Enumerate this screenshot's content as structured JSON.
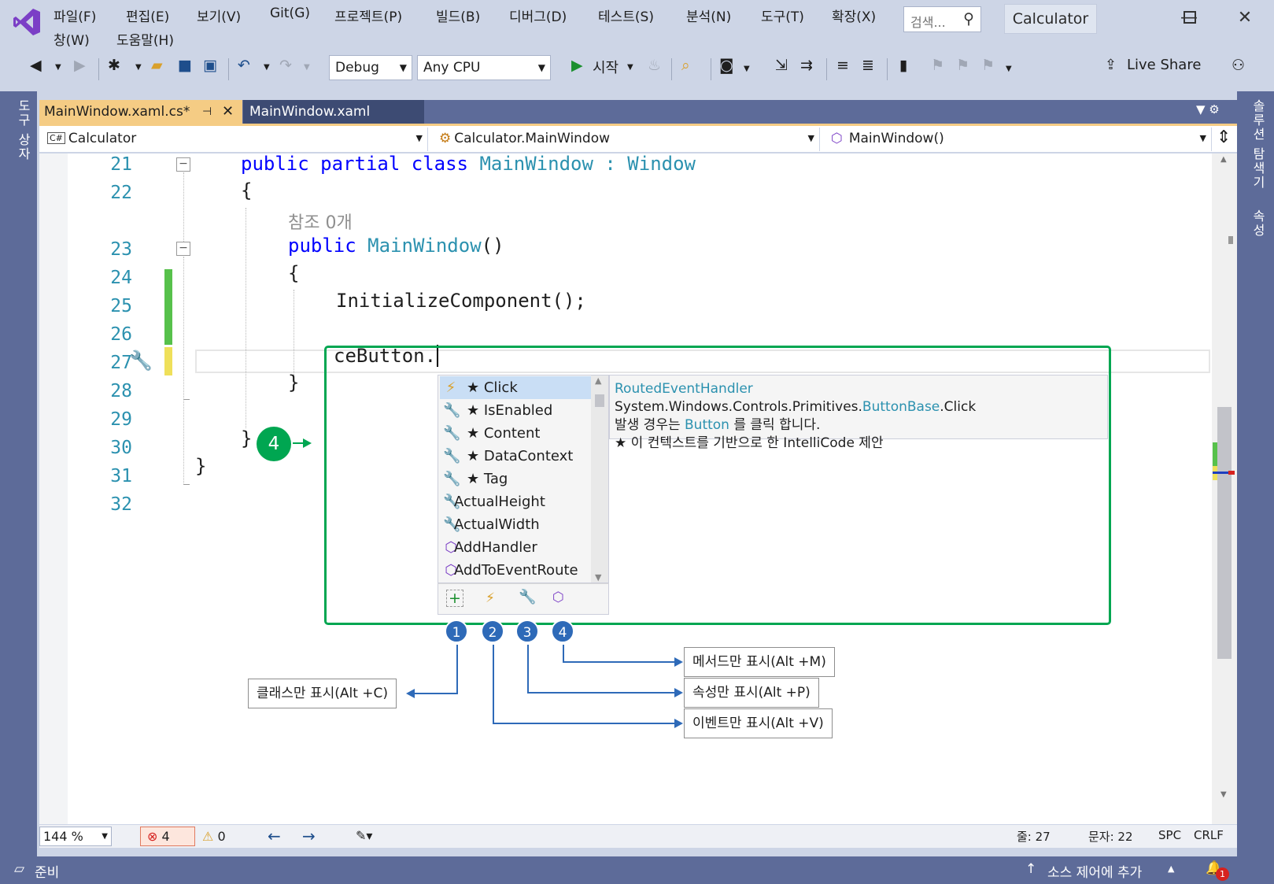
{
  "menu": {
    "items_row1": [
      "파일(F)",
      "편집(E)",
      "보기(V)",
      "Git(G)",
      "프로젝트(P)",
      "빌드(B)",
      "디버그(D)",
      "테스트(S)",
      "분석(N)",
      "도구(T)",
      "확장(X)"
    ],
    "items_row2": [
      "창(W)",
      "도움말(H)"
    ],
    "search_placeholder": "검색...",
    "app_title": "Calculator"
  },
  "toolbar": {
    "config": "Debug",
    "platform": "Any CPU",
    "start_label": "시작",
    "live_share": "Live Share"
  },
  "left_rail": {
    "toolbox": "도구 상자"
  },
  "right_rail": {
    "solution_explorer": "솔루션 탐색기",
    "properties": "속성"
  },
  "tabs": {
    "active": "MainWindow.xaml.cs*",
    "inactive": "MainWindow.xaml"
  },
  "navbar": {
    "project": "Calculator",
    "project_badge": "C#",
    "type": "Calculator.MainWindow",
    "member": "MainWindow()"
  },
  "editor": {
    "line_numbers": [
      "21",
      "22",
      "23",
      "24",
      "25",
      "26",
      "27",
      "28",
      "29",
      "30",
      "31",
      "32"
    ],
    "code": {
      "l21_kw": "public partial class ",
      "l21_type": "MainWindow",
      "l21_colon": " : ",
      "l21_base": "Window",
      "l22": "{",
      "codelens": "참조 0개",
      "l23_kw": "public ",
      "l23_name": "MainWindow",
      "l23_paren": "()",
      "l24": "{",
      "l25": "InitializeComponent();",
      "l27": "ceButton.",
      "l28": "}",
      "l30": "}",
      "l31": "}"
    }
  },
  "completion": {
    "items": [
      {
        "icon": "event-icon",
        "label": "★ Click",
        "selected": true
      },
      {
        "icon": "property-icon",
        "label": "★ IsEnabled"
      },
      {
        "icon": "property-icon",
        "label": "★ Content"
      },
      {
        "icon": "property-icon",
        "label": "★ DataContext"
      },
      {
        "icon": "property-icon",
        "label": "★ Tag"
      },
      {
        "icon": "property-icon",
        "label": "ActualHeight"
      },
      {
        "icon": "property-icon",
        "label": "ActualWidth"
      },
      {
        "icon": "method-icon",
        "label": "AddHandler"
      },
      {
        "icon": "method-icon",
        "label": "AddToEventRoute"
      }
    ]
  },
  "tooltip": {
    "sig_type": "RoutedEventHandler",
    "sig_ns": " System.Windows.Controls.Primitives.",
    "sig_class": "ButtonBase",
    "sig_member": ".Click",
    "desc_pre": "발생 경우는 ",
    "desc_link": "Button",
    "desc_post": " 를 클릭 합니다.",
    "intellicode": "★  이 컨텍스트를 기반으로 한 IntelliCode 제안"
  },
  "callouts": {
    "m1": "1",
    "m2": "2",
    "m3": "3",
    "m4": "4",
    "green4": "4",
    "class_only": "클래스만 표시(Alt +C)",
    "method_only": "메서드만 표시(Alt +M)",
    "property_only": "속성만 표시(Alt +P)",
    "event_only": "이벤트만 표시(Alt +V)"
  },
  "editor_status": {
    "zoom": "144 %",
    "errors": "4",
    "warnings": "0",
    "line": "줄: 27",
    "col": "문자: 22",
    "spacing": "SPC",
    "eol": "CRLF"
  },
  "statusbar": {
    "ready": "준비",
    "source_control": "소스 제어에 추가",
    "notifications": "1"
  },
  "colors": {
    "accent_green": "#00a651",
    "marker_blue": "#2e6ab8",
    "tab_active": "#f5cc84",
    "chrome": "#5d6b99"
  }
}
